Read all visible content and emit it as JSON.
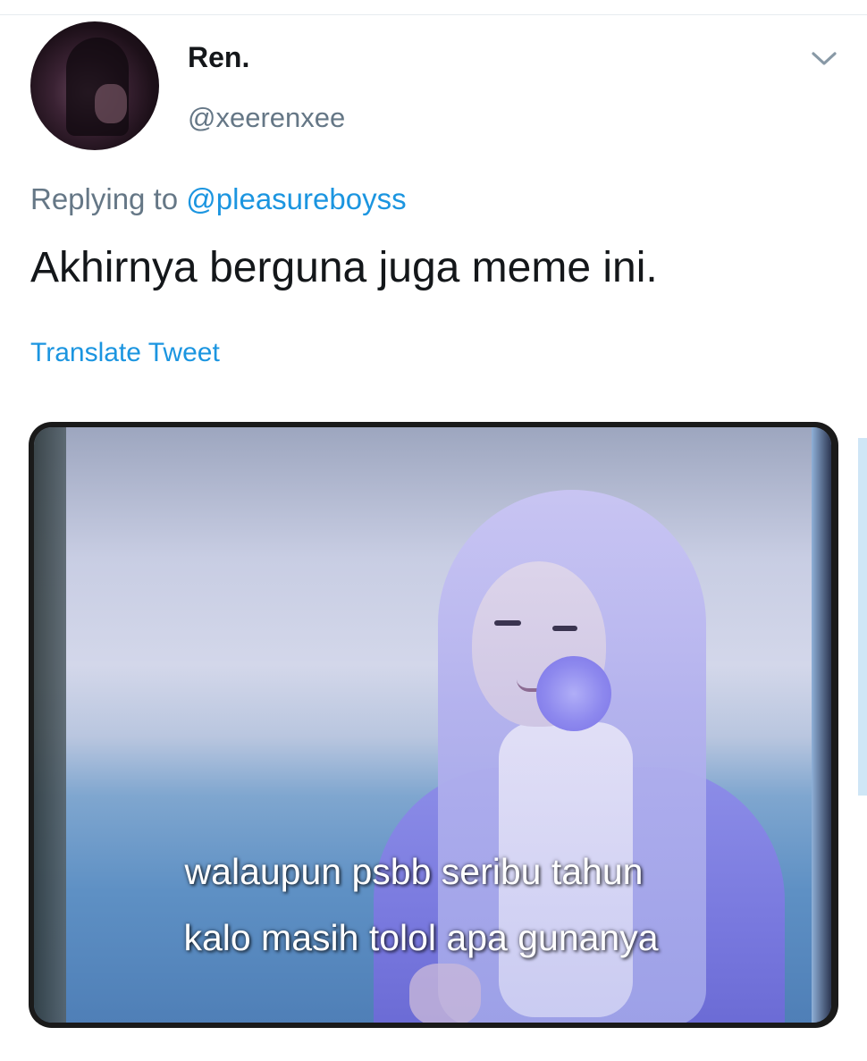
{
  "tweet": {
    "display_name": "Ren.",
    "handle": "@xeerenxee",
    "reply_prefix": "Replying to",
    "reply_to": "@pleasureboyss",
    "text": "Akhirnya berguna juga meme ini.",
    "translate_label": "Translate Tweet"
  },
  "media": {
    "caption_line1": "walaupun psbb seribu tahun",
    "caption_line2": "kalo masih tolol apa gunanya"
  },
  "icons": {
    "menu": "chevron-down-icon"
  },
  "colors": {
    "link": "#1b95e0",
    "secondary_text": "#657786",
    "primary_text": "#14171a"
  }
}
